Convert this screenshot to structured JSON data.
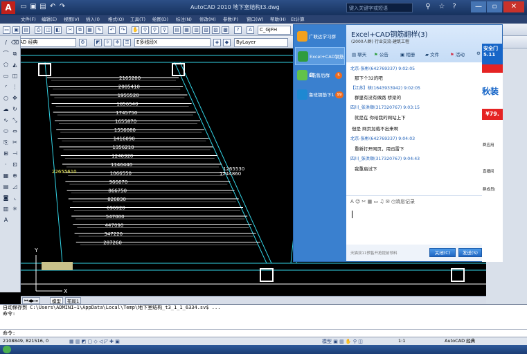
{
  "window": {
    "title": "AutoCAD 2010    地下室结构t3.dwg",
    "search_placeholder": "键入关键字或短语",
    "controls": [
      "—",
      "▫",
      "✕"
    ]
  },
  "menu": [
    "文件(F)",
    "编辑(E)",
    "视图(V)",
    "插入(I)",
    "格式(O)",
    "工具(T)",
    "绘图(D)",
    "标注(N)",
    "修改(M)",
    "参数(P)",
    "窗口(W)",
    "帮助(H)",
    "Et计算"
  ],
  "toolbar": {
    "workspace": "AutoCAD 经典",
    "dim_style": "ISO-25",
    "multileader_style": "E多线段X",
    "text_style": "C_GJFH",
    "layer": "ByLayer"
  },
  "drawing": {
    "dims": [
      "2165200",
      "2005410",
      "1955520",
      "1856540",
      "1745750",
      "1655870",
      "1556080",
      "1416090",
      "1356210",
      "1246320",
      "1146440",
      "1066550",
      "966670",
      "866750",
      "826830",
      "696920",
      "547000",
      "447090",
      "347220",
      "287260"
    ],
    "left_label": "22655610",
    "right_label": "1265530",
    "right_label2": "1244860"
  },
  "layout_tabs": [
    "模型",
    "布局1"
  ],
  "command": {
    "history": [
      "自动保存到 C:\\Users\\ADMINI~1\\AppData\\Local\\Temp\\地下室结构_t3_1_1_6334.sv$ ...",
      "命令:"
    ],
    "prompt": "命令:"
  },
  "status": {
    "coords": "2108849, 821516, 0",
    "scale": "1:1",
    "workspace": "AutoCAD 经典"
  },
  "qq": {
    "groups": [
      {
        "name": "广联达学习群",
        "badge": ""
      },
      {
        "name": "Excel+CAD钢筋翻",
        "badge": ""
      },
      {
        "name": "E筋售后群",
        "badge": "5"
      },
      {
        "name": "鲁班钢筋下1",
        "badge": "99"
      }
    ],
    "chat_title": "Excel+CAD钢筋翻样(3)",
    "chat_subtitle": "(2000人群) 行业交流-建筑工程",
    "tools": [
      "聊天",
      "公告",
      "相册",
      "文件",
      "活动"
    ],
    "messages": [
      {
        "sender": "北京-张彬(642769337)",
        "time": "9:02:05",
        "text": "那下个32的吧"
      },
      {
        "sender": "【江苏】核(1643933942)",
        "time": "9:02:05",
        "text": "群里有没有做路 桥梁的"
      },
      {
        "sender": "四川_张洪顺(317320767)",
        "time": "9:03:15",
        "text": "就是在 你给我的网站上下"
      },
      {
        "sender": "",
        "time": "",
        "text": "但是 网页加载不出来啊"
      },
      {
        "sender": "北京-张彬(642769337)",
        "time": "9:04:03",
        "text": "重新打开网页，用迅雷下"
      },
      {
        "sender": "四川_张洪顺(317320767)",
        "time": "9:04:43",
        "text": "我重启试下"
      }
    ],
    "input_tools": "A ☺ ✂ ▦ ▭ ♫ ✉ ◷消息记录",
    "footer_hint": "天猫双11预售开抢提前领料",
    "close_btn": "关闭(C)",
    "send_btn": "发送(S)"
  },
  "ad": {
    "top": "安全门 5.11",
    "big": "秋装",
    "price": "¥79.",
    "labels": [
      "群应用",
      "直播间",
      "群成员("
    ]
  },
  "colors": {
    "title_blue": "#1c3a6a",
    "qq_blue": "#3a80cf",
    "cad_bg": "#000000",
    "cyan_line": "#33d6e8",
    "white_line": "#ffffff"
  }
}
